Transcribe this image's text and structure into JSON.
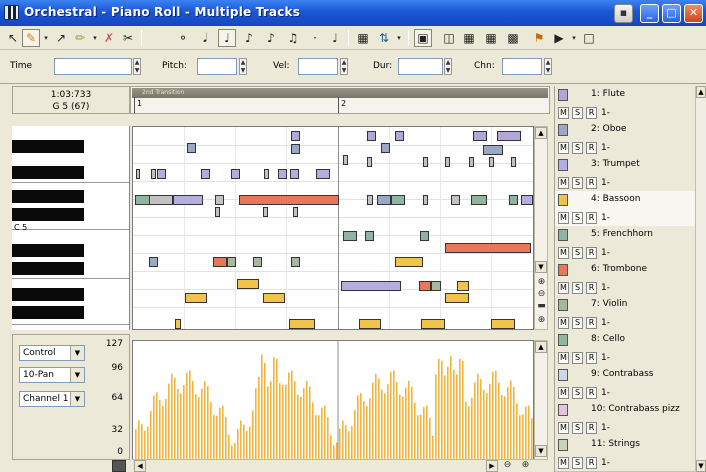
{
  "window": {
    "title": "Orchestral - Piano Roll - Multiple Tracks"
  },
  "fields": {
    "time": "Time",
    "pitch": "Pitch:",
    "vel": "Vel:",
    "dur": "Dur:",
    "chn": "Chn:"
  },
  "readout": {
    "time": "1:03:733",
    "note": "G 5 (67)"
  },
  "ruler": {
    "marker": "2nd Transition",
    "m1": "1",
    "m2": "2"
  },
  "keyboard": {
    "c5": "C 5"
  },
  "controller": {
    "control": "Control",
    "param": "10-Pan",
    "channel": "Channel 1",
    "v127": "127",
    "v96": "96",
    "v64": "64",
    "v32": "32",
    "v0": "0"
  },
  "track_buttons": {
    "mute": "M",
    "solo": "S",
    "rec": "R"
  },
  "tracks": [
    {
      "name": "1: Flute",
      "channel": "1-",
      "color": "#b2a8d8"
    },
    {
      "name": "2: Oboe",
      "channel": "1-",
      "color": "#9aa8c8"
    },
    {
      "name": "3: Trumpet",
      "channel": "1-",
      "color": "#b4aee0"
    },
    {
      "name": "4: Bassoon",
      "channel": "1-",
      "color": "#f2c34a"
    },
    {
      "name": "5: Frenchhorn",
      "channel": "1-",
      "color": "#8eb4a2"
    },
    {
      "name": "6: Trombone",
      "channel": "1-",
      "color": "#e9785a"
    },
    {
      "name": "7: Violin",
      "channel": "1-",
      "color": "#a8b8a0"
    },
    {
      "name": "8: Cello",
      "channel": "1-",
      "color": "#8fb89c"
    },
    {
      "name": "9: Contrabass",
      "channel": "1-",
      "color": "#cfd7e6"
    },
    {
      "name": "10: Contrabass pizz",
      "channel": "1-",
      "color": "#e2c4dc"
    },
    {
      "name": "11: Strings",
      "channel": "1-",
      "color": "#c8d2b8"
    }
  ]
}
